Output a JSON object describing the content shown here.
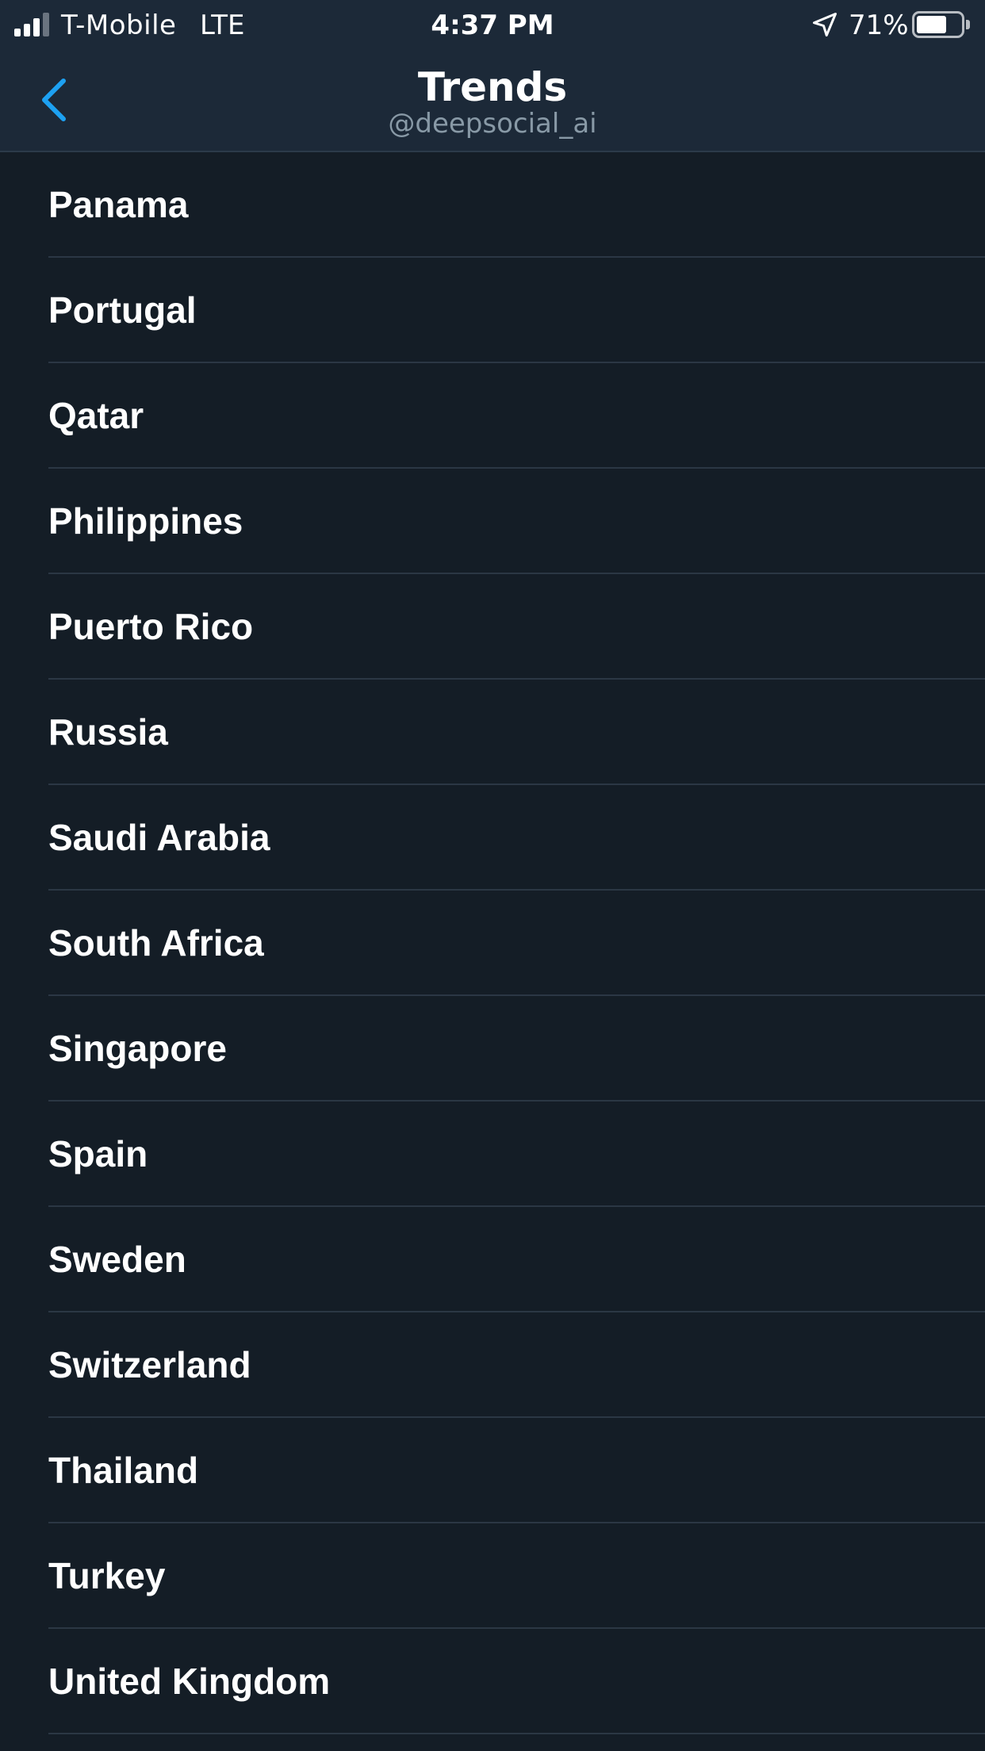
{
  "status_bar": {
    "carrier": "T-Mobile",
    "network": "LTE",
    "time": "4:37 PM",
    "battery_percent": "71%",
    "battery_level": 0.71,
    "signal_icon": "signal-bars-icon",
    "location_icon": "location-arrow-icon",
    "battery_icon": "battery-icon"
  },
  "nav": {
    "title": "Trends",
    "subtitle": "@deepsocial_ai",
    "back_icon": "chevron-left-icon",
    "accent_color": "#1da1f2"
  },
  "locations": [
    "Panama",
    "Portugal",
    "Qatar",
    "Philippines",
    "Puerto Rico",
    "Russia",
    "Saudi Arabia",
    "South Africa",
    "Singapore",
    "Spain",
    "Sweden",
    "Switzerland",
    "Thailand",
    "Turkey",
    "United Kingdom"
  ]
}
